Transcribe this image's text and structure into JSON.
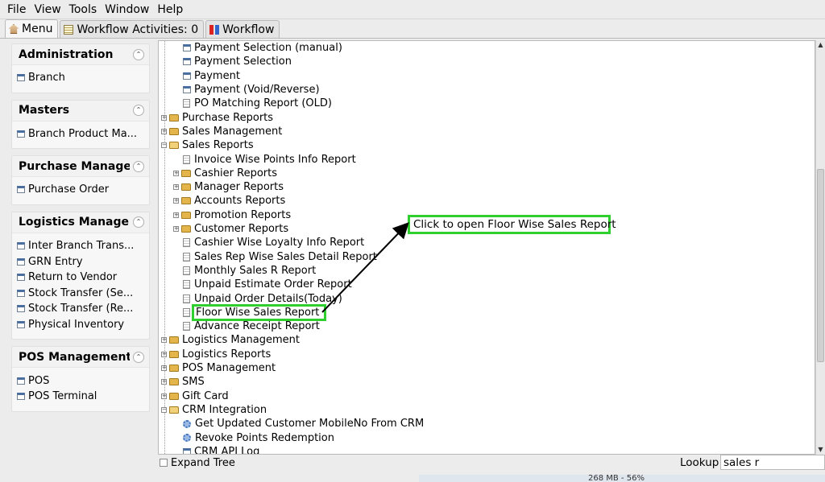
{
  "menubar": {
    "file": "File",
    "view": "View",
    "tools": "Tools",
    "window": "Window",
    "help": "Help"
  },
  "tabs": [
    {
      "label": "Menu",
      "active": true
    },
    {
      "label": "Workflow Activities: 0"
    },
    {
      "label": "Workflow"
    }
  ],
  "left_panel": {
    "groups": [
      {
        "title": "Administration",
        "items": [
          "Branch"
        ]
      },
      {
        "title": "Masters",
        "items": [
          "Branch Product Ma..."
        ]
      },
      {
        "title": "Purchase Manage...",
        "items": [
          "Purchase Order"
        ]
      },
      {
        "title": "Logistics Manage...",
        "items": [
          "Inter Branch Trans...",
          "GRN Entry",
          "Return to Vendor",
          "Stock Transfer (Se...",
          "Stock Transfer (Re...",
          "Physical Inventory"
        ]
      },
      {
        "title": "POS Management",
        "items": [
          "POS",
          "POS Terminal"
        ]
      }
    ]
  },
  "tree": {
    "rows": [
      {
        "label": "Payment Selection (manual)",
        "icon": "window-icon",
        "level": 2
      },
      {
        "label": "Payment Selection",
        "icon": "window-icon",
        "level": 2
      },
      {
        "label": "Payment",
        "icon": "window-icon",
        "level": 2
      },
      {
        "label": "Payment (Void/Reverse)",
        "icon": "window-icon",
        "level": 2
      },
      {
        "label": "PO Matching Report (OLD)",
        "icon": "document-icon",
        "level": 2
      },
      {
        "label": "Purchase Reports",
        "icon": "folder-icon",
        "level": 1
      },
      {
        "label": "Sales Management",
        "icon": "folder-icon",
        "level": 1
      },
      {
        "label": "Sales Reports",
        "icon": "folder-open-icon",
        "level": 1
      },
      {
        "label": "Invoice Wise Points Info Report",
        "icon": "document-icon",
        "level": 2
      },
      {
        "label": "Cashier Reports",
        "icon": "folder-icon",
        "level": 2
      },
      {
        "label": "Manager Reports",
        "icon": "folder-icon",
        "level": 2
      },
      {
        "label": "Accounts Reports",
        "icon": "folder-icon",
        "level": 2
      },
      {
        "label": "Promotion Reports",
        "icon": "folder-icon",
        "level": 2
      },
      {
        "label": "Customer Reports",
        "icon": "folder-icon",
        "level": 2
      },
      {
        "label": "Cashier Wise Loyalty Info Report",
        "icon": "document-icon",
        "level": 2
      },
      {
        "label": "Sales Rep Wise Sales Detail Report",
        "icon": "document-icon",
        "level": 2
      },
      {
        "label": "Monthly Sales R Report",
        "icon": "document-icon",
        "level": 2
      },
      {
        "label": "Unpaid Estimate Order Report",
        "icon": "document-icon",
        "level": 2
      },
      {
        "label": "Unpaid Order Details(Today)",
        "icon": "document-icon",
        "level": 2
      },
      {
        "label": "Floor Wise Sales Report",
        "icon": "document-icon",
        "level": 2
      },
      {
        "label": "Advance Receipt Report",
        "icon": "document-icon",
        "level": 2
      },
      {
        "label": "Logistics Management",
        "icon": "folder-icon",
        "level": 1
      },
      {
        "label": "Logistics Reports",
        "icon": "folder-icon",
        "level": 1
      },
      {
        "label": "POS Management",
        "icon": "folder-icon",
        "level": 1
      },
      {
        "label": "SMS",
        "icon": "folder-icon",
        "level": 1
      },
      {
        "label": "Gift Card",
        "icon": "folder-icon",
        "level": 1
      },
      {
        "label": "CRM Integration",
        "icon": "folder-open-icon",
        "level": 1
      },
      {
        "label": "Get Updated Customer MobileNo From CRM",
        "icon": "gear-icon",
        "level": 2
      },
      {
        "label": "Revoke Points Redemption",
        "icon": "gear-icon",
        "level": 2
      },
      {
        "label": "CRM API Log",
        "icon": "window-icon",
        "level": 2
      }
    ]
  },
  "callout": {
    "text": "Click to open Floor Wise Sales Report"
  },
  "bottom": {
    "expand_tree": "Expand Tree",
    "lookup_label": "Lookup",
    "lookup_value": "sales r"
  },
  "status": {
    "memory": "268 MB - 56%"
  },
  "colors": {
    "highlight": "#2fcf2f",
    "arrow": "#000000"
  }
}
